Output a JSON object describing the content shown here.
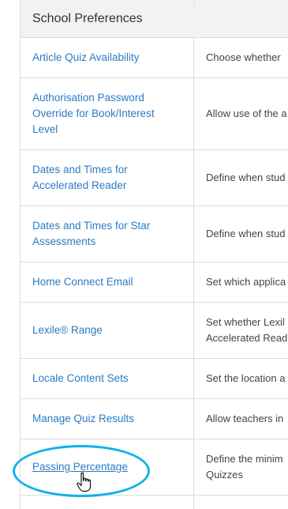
{
  "section": {
    "title": "School Preferences"
  },
  "rows": [
    {
      "name": "Article Quiz Availability",
      "desc": "Choose whether"
    },
    {
      "name": "Authorisation Password\nOverride for Book/Interest\nLevel",
      "desc": "Allow use of the a"
    },
    {
      "name": "Dates and Times for\nAccelerated Reader",
      "desc": "Define when stud"
    },
    {
      "name": "Dates and Times for Star\nAssessments",
      "desc": "Define when stud"
    },
    {
      "name": "Home Connect Email",
      "desc": "Set which applica"
    },
    {
      "name": "Lexile® Range",
      "desc": "Set whether Lexil\nAccelerated Read"
    },
    {
      "name": "Locale Content Sets",
      "desc": "Set the location a"
    },
    {
      "name": "Manage Quiz Results",
      "desc": "Allow teachers in"
    },
    {
      "name": "Passing Percentage",
      "desc": "Define the minim\nQuizzes"
    }
  ],
  "annotation": {
    "highlight_color": "#12b0e8",
    "icon": "hand-pointer-icon"
  }
}
